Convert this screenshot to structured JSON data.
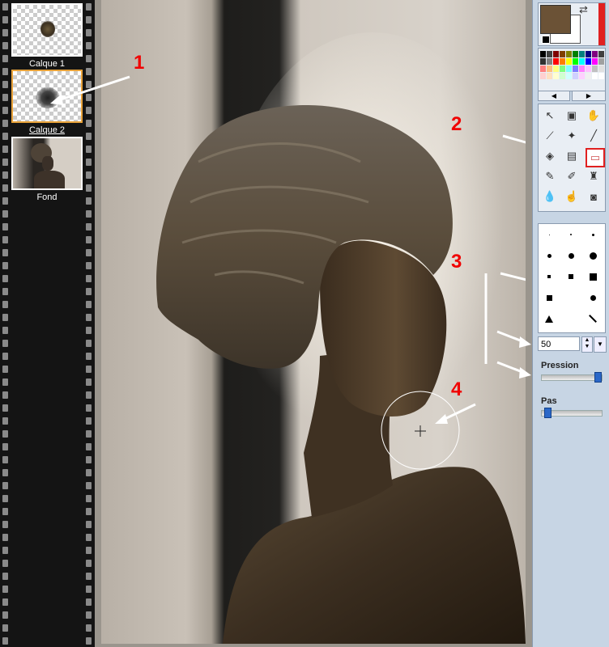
{
  "layers": [
    {
      "label": "Calque 1",
      "selected": false
    },
    {
      "label": "Calque 2",
      "selected": true
    },
    {
      "label": "Fond",
      "selected": false
    }
  ],
  "annotations": [
    "1",
    "2",
    "3",
    "4"
  ],
  "colors": {
    "primary": "#6b5236",
    "secondary": "#ffffff",
    "accent_selection": "#e8a23a",
    "highlight_border": "#e02020",
    "annotation_red": "#f00000"
  },
  "palette": [
    "#000000",
    "#404040",
    "#7f0000",
    "#7f3f00",
    "#7f7f00",
    "#007f00",
    "#007f7f",
    "#00007f",
    "#7f007f",
    "#404040",
    "#303030",
    "#808080",
    "#ff0000",
    "#ff7f00",
    "#ffff00",
    "#00ff00",
    "#00ffff",
    "#0000ff",
    "#ff00ff",
    "#a0a0a0",
    "#ff8080",
    "#ffbf80",
    "#ffff80",
    "#80ff80",
    "#80ffff",
    "#8080ff",
    "#ff80ff",
    "#ffc0ff",
    "#c0c0c0",
    "#e0e0e0"
  ],
  "tools": [
    [
      "pointer-icon",
      "layer-icon",
      "hand-icon"
    ],
    [
      "dropper-icon",
      "magic-wand-icon",
      "line-icon"
    ],
    [
      "fill-icon",
      "document-icon",
      "eraser-icon"
    ],
    [
      "brush-icon",
      "pen-icon",
      "stamp-icon"
    ],
    [
      "drop-icon",
      "smudge-icon",
      "portrait-icon"
    ]
  ],
  "brush_size": {
    "value": "50"
  },
  "pressure": {
    "label": "Pression",
    "level_pct": 95
  },
  "step": {
    "label": "Pas",
    "level_pct": 5
  }
}
